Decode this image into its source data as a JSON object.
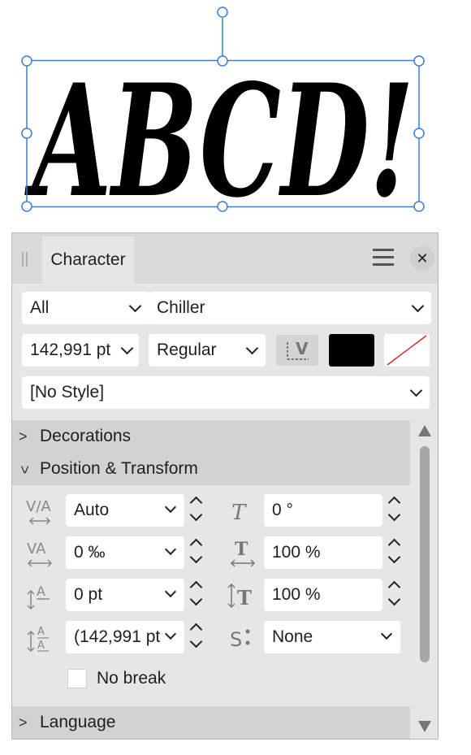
{
  "canvas": {
    "text": "ABCD!",
    "selection_color": "#3c7fd4"
  },
  "panel": {
    "tab_title": "Character",
    "menu_icon": "hamburger-icon",
    "close_icon": "close-icon",
    "close_glyph": "✕",
    "scope_select": "All",
    "font_family": "Chiller",
    "font_size": "142,991 pt",
    "font_style": "Regular",
    "text_style": "[No Style]",
    "text_color": "#000000",
    "background_color": "none",
    "sections": {
      "decorations": "Decorations",
      "position_transform": "Position & Transform",
      "language": "Language"
    },
    "position_transform": {
      "kerning": {
        "icon": "kerning-icon",
        "value": "Auto"
      },
      "shear": {
        "icon": "italic-shear-icon",
        "value": "0 °"
      },
      "tracking": {
        "icon": "tracking-icon",
        "value": "0 ‰"
      },
      "horizontal_scale": {
        "icon": "horizontal-scale-icon",
        "value": "100 %"
      },
      "baseline_shift": {
        "icon": "baseline-shift-icon",
        "value": "0 pt"
      },
      "vertical_scale": {
        "icon": "vertical-scale-icon",
        "value": "100 %"
      },
      "leading": {
        "icon": "leading-icon",
        "value": "(142,991 pt)"
      },
      "superscript": {
        "icon": "superscript-icon",
        "value": "None"
      }
    },
    "no_break_label": "No break",
    "no_break_checked": false
  }
}
